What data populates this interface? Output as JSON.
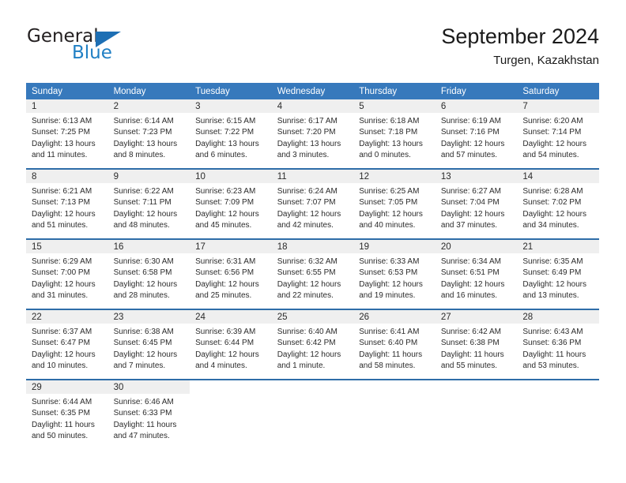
{
  "brand": {
    "name_part1": "General",
    "name_part2": "Blue",
    "logo_icon": "triangle-icon"
  },
  "header": {
    "title": "September 2024",
    "location": "Turgen, Kazakhstan"
  },
  "calendar": {
    "weekday_headers": [
      "Sunday",
      "Monday",
      "Tuesday",
      "Wednesday",
      "Thursday",
      "Friday",
      "Saturday"
    ],
    "accent_color": "#3779bc",
    "row_divider_color": "#2e6da8",
    "daynum_bg_color": "#efefef",
    "weeks": [
      [
        {
          "day": "1",
          "sunrise": "Sunrise: 6:13 AM",
          "sunset": "Sunset: 7:25 PM",
          "daylight_l1": "Daylight: 13 hours",
          "daylight_l2": "and 11 minutes."
        },
        {
          "day": "2",
          "sunrise": "Sunrise: 6:14 AM",
          "sunset": "Sunset: 7:23 PM",
          "daylight_l1": "Daylight: 13 hours",
          "daylight_l2": "and 8 minutes."
        },
        {
          "day": "3",
          "sunrise": "Sunrise: 6:15 AM",
          "sunset": "Sunset: 7:22 PM",
          "daylight_l1": "Daylight: 13 hours",
          "daylight_l2": "and 6 minutes."
        },
        {
          "day": "4",
          "sunrise": "Sunrise: 6:17 AM",
          "sunset": "Sunset: 7:20 PM",
          "daylight_l1": "Daylight: 13 hours",
          "daylight_l2": "and 3 minutes."
        },
        {
          "day": "5",
          "sunrise": "Sunrise: 6:18 AM",
          "sunset": "Sunset: 7:18 PM",
          "daylight_l1": "Daylight: 13 hours",
          "daylight_l2": "and 0 minutes."
        },
        {
          "day": "6",
          "sunrise": "Sunrise: 6:19 AM",
          "sunset": "Sunset: 7:16 PM",
          "daylight_l1": "Daylight: 12 hours",
          "daylight_l2": "and 57 minutes."
        },
        {
          "day": "7",
          "sunrise": "Sunrise: 6:20 AM",
          "sunset": "Sunset: 7:14 PM",
          "daylight_l1": "Daylight: 12 hours",
          "daylight_l2": "and 54 minutes."
        }
      ],
      [
        {
          "day": "8",
          "sunrise": "Sunrise: 6:21 AM",
          "sunset": "Sunset: 7:13 PM",
          "daylight_l1": "Daylight: 12 hours",
          "daylight_l2": "and 51 minutes."
        },
        {
          "day": "9",
          "sunrise": "Sunrise: 6:22 AM",
          "sunset": "Sunset: 7:11 PM",
          "daylight_l1": "Daylight: 12 hours",
          "daylight_l2": "and 48 minutes."
        },
        {
          "day": "10",
          "sunrise": "Sunrise: 6:23 AM",
          "sunset": "Sunset: 7:09 PM",
          "daylight_l1": "Daylight: 12 hours",
          "daylight_l2": "and 45 minutes."
        },
        {
          "day": "11",
          "sunrise": "Sunrise: 6:24 AM",
          "sunset": "Sunset: 7:07 PM",
          "daylight_l1": "Daylight: 12 hours",
          "daylight_l2": "and 42 minutes."
        },
        {
          "day": "12",
          "sunrise": "Sunrise: 6:25 AM",
          "sunset": "Sunset: 7:05 PM",
          "daylight_l1": "Daylight: 12 hours",
          "daylight_l2": "and 40 minutes."
        },
        {
          "day": "13",
          "sunrise": "Sunrise: 6:27 AM",
          "sunset": "Sunset: 7:04 PM",
          "daylight_l1": "Daylight: 12 hours",
          "daylight_l2": "and 37 minutes."
        },
        {
          "day": "14",
          "sunrise": "Sunrise: 6:28 AM",
          "sunset": "Sunset: 7:02 PM",
          "daylight_l1": "Daylight: 12 hours",
          "daylight_l2": "and 34 minutes."
        }
      ],
      [
        {
          "day": "15",
          "sunrise": "Sunrise: 6:29 AM",
          "sunset": "Sunset: 7:00 PM",
          "daylight_l1": "Daylight: 12 hours",
          "daylight_l2": "and 31 minutes."
        },
        {
          "day": "16",
          "sunrise": "Sunrise: 6:30 AM",
          "sunset": "Sunset: 6:58 PM",
          "daylight_l1": "Daylight: 12 hours",
          "daylight_l2": "and 28 minutes."
        },
        {
          "day": "17",
          "sunrise": "Sunrise: 6:31 AM",
          "sunset": "Sunset: 6:56 PM",
          "daylight_l1": "Daylight: 12 hours",
          "daylight_l2": "and 25 minutes."
        },
        {
          "day": "18",
          "sunrise": "Sunrise: 6:32 AM",
          "sunset": "Sunset: 6:55 PM",
          "daylight_l1": "Daylight: 12 hours",
          "daylight_l2": "and 22 minutes."
        },
        {
          "day": "19",
          "sunrise": "Sunrise: 6:33 AM",
          "sunset": "Sunset: 6:53 PM",
          "daylight_l1": "Daylight: 12 hours",
          "daylight_l2": "and 19 minutes."
        },
        {
          "day": "20",
          "sunrise": "Sunrise: 6:34 AM",
          "sunset": "Sunset: 6:51 PM",
          "daylight_l1": "Daylight: 12 hours",
          "daylight_l2": "and 16 minutes."
        },
        {
          "day": "21",
          "sunrise": "Sunrise: 6:35 AM",
          "sunset": "Sunset: 6:49 PM",
          "daylight_l1": "Daylight: 12 hours",
          "daylight_l2": "and 13 minutes."
        }
      ],
      [
        {
          "day": "22",
          "sunrise": "Sunrise: 6:37 AM",
          "sunset": "Sunset: 6:47 PM",
          "daylight_l1": "Daylight: 12 hours",
          "daylight_l2": "and 10 minutes."
        },
        {
          "day": "23",
          "sunrise": "Sunrise: 6:38 AM",
          "sunset": "Sunset: 6:45 PM",
          "daylight_l1": "Daylight: 12 hours",
          "daylight_l2": "and 7 minutes."
        },
        {
          "day": "24",
          "sunrise": "Sunrise: 6:39 AM",
          "sunset": "Sunset: 6:44 PM",
          "daylight_l1": "Daylight: 12 hours",
          "daylight_l2": "and 4 minutes."
        },
        {
          "day": "25",
          "sunrise": "Sunrise: 6:40 AM",
          "sunset": "Sunset: 6:42 PM",
          "daylight_l1": "Daylight: 12 hours",
          "daylight_l2": "and 1 minute."
        },
        {
          "day": "26",
          "sunrise": "Sunrise: 6:41 AM",
          "sunset": "Sunset: 6:40 PM",
          "daylight_l1": "Daylight: 11 hours",
          "daylight_l2": "and 58 minutes."
        },
        {
          "day": "27",
          "sunrise": "Sunrise: 6:42 AM",
          "sunset": "Sunset: 6:38 PM",
          "daylight_l1": "Daylight: 11 hours",
          "daylight_l2": "and 55 minutes."
        },
        {
          "day": "28",
          "sunrise": "Sunrise: 6:43 AM",
          "sunset": "Sunset: 6:36 PM",
          "daylight_l1": "Daylight: 11 hours",
          "daylight_l2": "and 53 minutes."
        }
      ],
      [
        {
          "day": "29",
          "sunrise": "Sunrise: 6:44 AM",
          "sunset": "Sunset: 6:35 PM",
          "daylight_l1": "Daylight: 11 hours",
          "daylight_l2": "and 50 minutes."
        },
        {
          "day": "30",
          "sunrise": "Sunrise: 6:46 AM",
          "sunset": "Sunset: 6:33 PM",
          "daylight_l1": "Daylight: 11 hours",
          "daylight_l2": "and 47 minutes."
        },
        {
          "day": "",
          "sunrise": "",
          "sunset": "",
          "daylight_l1": "",
          "daylight_l2": ""
        },
        {
          "day": "",
          "sunrise": "",
          "sunset": "",
          "daylight_l1": "",
          "daylight_l2": ""
        },
        {
          "day": "",
          "sunrise": "",
          "sunset": "",
          "daylight_l1": "",
          "daylight_l2": ""
        },
        {
          "day": "",
          "sunrise": "",
          "sunset": "",
          "daylight_l1": "",
          "daylight_l2": ""
        },
        {
          "day": "",
          "sunrise": "",
          "sunset": "",
          "daylight_l1": "",
          "daylight_l2": ""
        }
      ]
    ]
  }
}
